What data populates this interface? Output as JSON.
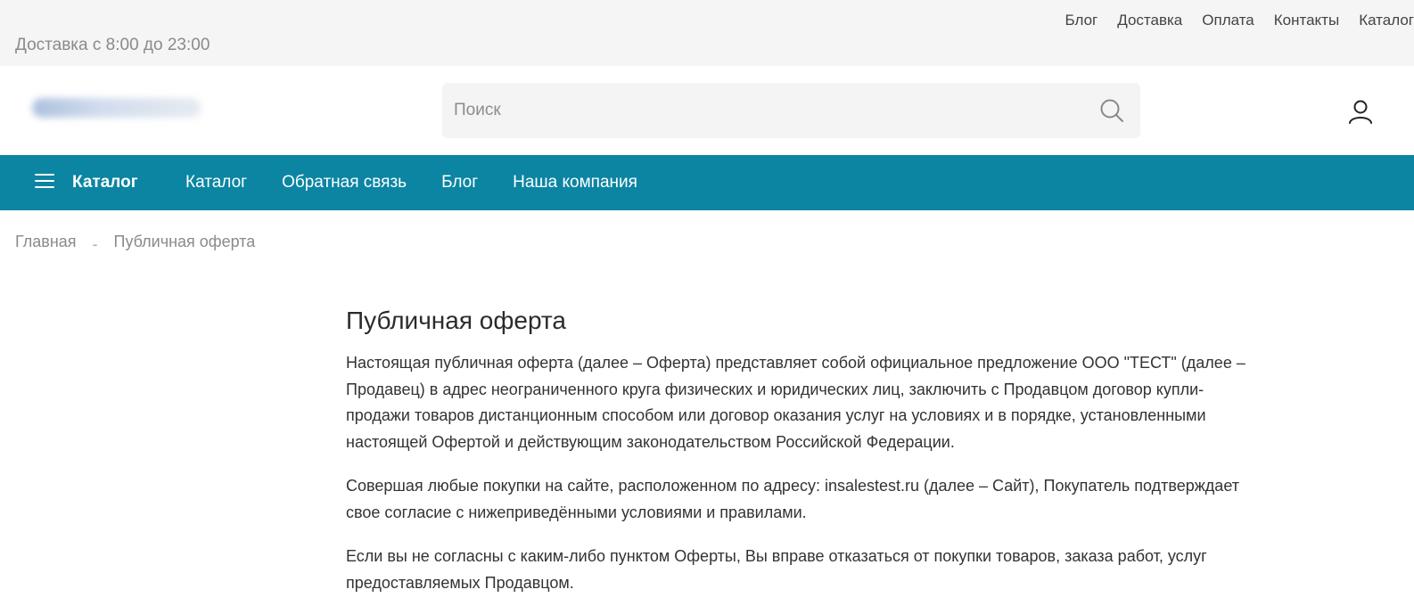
{
  "topbar": {
    "links": [
      "Блог",
      "Доставка",
      "Оплата",
      "Контакты",
      "Каталог"
    ],
    "delivery_text": "Доставка с 8:00 до 23:00"
  },
  "header": {
    "search_placeholder": "Поиск",
    "search_icon": "search-icon",
    "user_icon": "user-icon"
  },
  "navbar": {
    "menu_icon": "hamburger-menu-icon",
    "catalog_main": "Каталог",
    "links": [
      "Каталог",
      "Обратная связь",
      "Блог",
      "Наша компания"
    ]
  },
  "breadcrumb": {
    "home": "Главная",
    "separator": "-",
    "current": "Публичная оферта"
  },
  "content": {
    "title": "Публичная оферта",
    "paragraphs": [
      "Настоящая публичная оферта (далее – Оферта) представляет собой официальное предложение ООО \"ТЕСТ\" (далее – Продавец) в адрес неограниченного круга физических и юридических лиц, заключить с Продавцом договор купли-продажи товаров дистанционным способом или договор оказания услуг на условиях и в порядке, установленными настоящей Офертой и действующим законодательством Российской Федерации.",
      "Совершая любые покупки на сайте, расположенном по адресу: insalestest.ru (далее – Сайт), Покупатель подтверждает свое согласие с нижеприведёнными условиями и правилами.",
      "Если вы не согласны с каким-либо пунктом Оферты, Вы вправе отказаться от покупки товаров, заказа работ, услуг предоставляемых Продавцом."
    ]
  },
  "colors": {
    "nav_background": "#0b85a2",
    "topbar_background": "#f5f5f5"
  }
}
